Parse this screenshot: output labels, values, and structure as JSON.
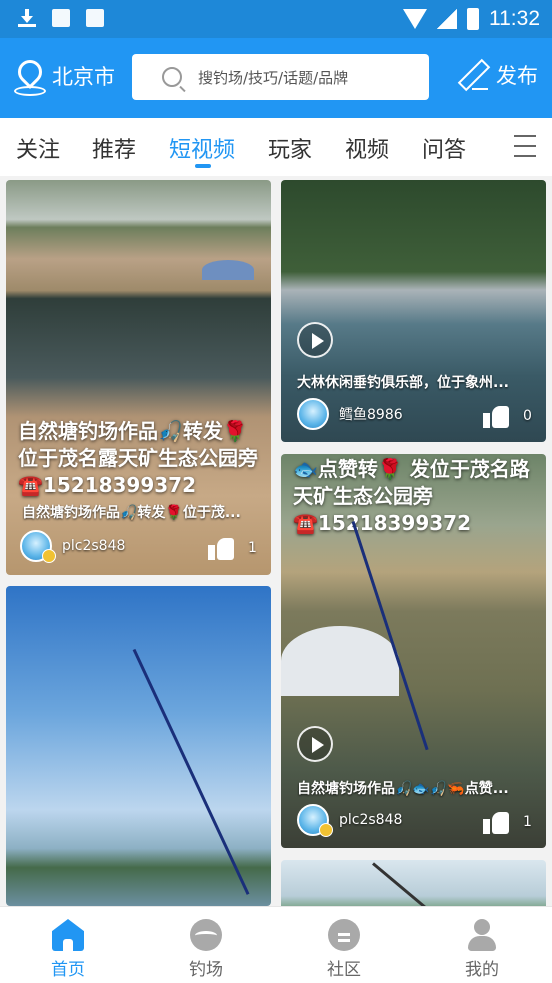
{
  "status_bar": {
    "time": "11:32"
  },
  "header": {
    "location": "北京市",
    "search_placeholder": "搜钓场/技巧/话题/品牌",
    "publish_label": "发布"
  },
  "tabs": [
    {
      "label": "关注"
    },
    {
      "label": "推荐"
    },
    {
      "label": "短视频",
      "active": true
    },
    {
      "label": "玩家"
    },
    {
      "label": "视频"
    },
    {
      "label": "问答"
    }
  ],
  "cards": [
    {
      "overlay": "自然塘钓场作品🎣转发🌹位于茂名露天矿生态公园旁☎️15218399372",
      "caption": "自然塘钓场作品🎣转发🌹位于茂...",
      "user": "plc2s848",
      "likes": "1"
    },
    {
      "caption": "大林休闲垂钓俱乐部，位于象州...",
      "user": "鳕鱼8986",
      "likes": "0"
    },
    {
      "overlay": "🐟点赞转🌹 发位于茂名路天矿生态公园旁☎️15218399372",
      "caption": "自然塘钓场作品🎣🐟🎣🦐点赞...",
      "user": "plc2s848",
      "likes": "1"
    }
  ],
  "bottom_nav": [
    {
      "label": "首页",
      "icon": "home-icon",
      "active": true
    },
    {
      "label": "钓场",
      "icon": "fishing-spot-icon"
    },
    {
      "label": "社区",
      "icon": "community-icon"
    },
    {
      "label": "我的",
      "icon": "profile-icon"
    }
  ],
  "colors": {
    "primary": "#2196f3",
    "status_bar": "#1e88d8"
  }
}
